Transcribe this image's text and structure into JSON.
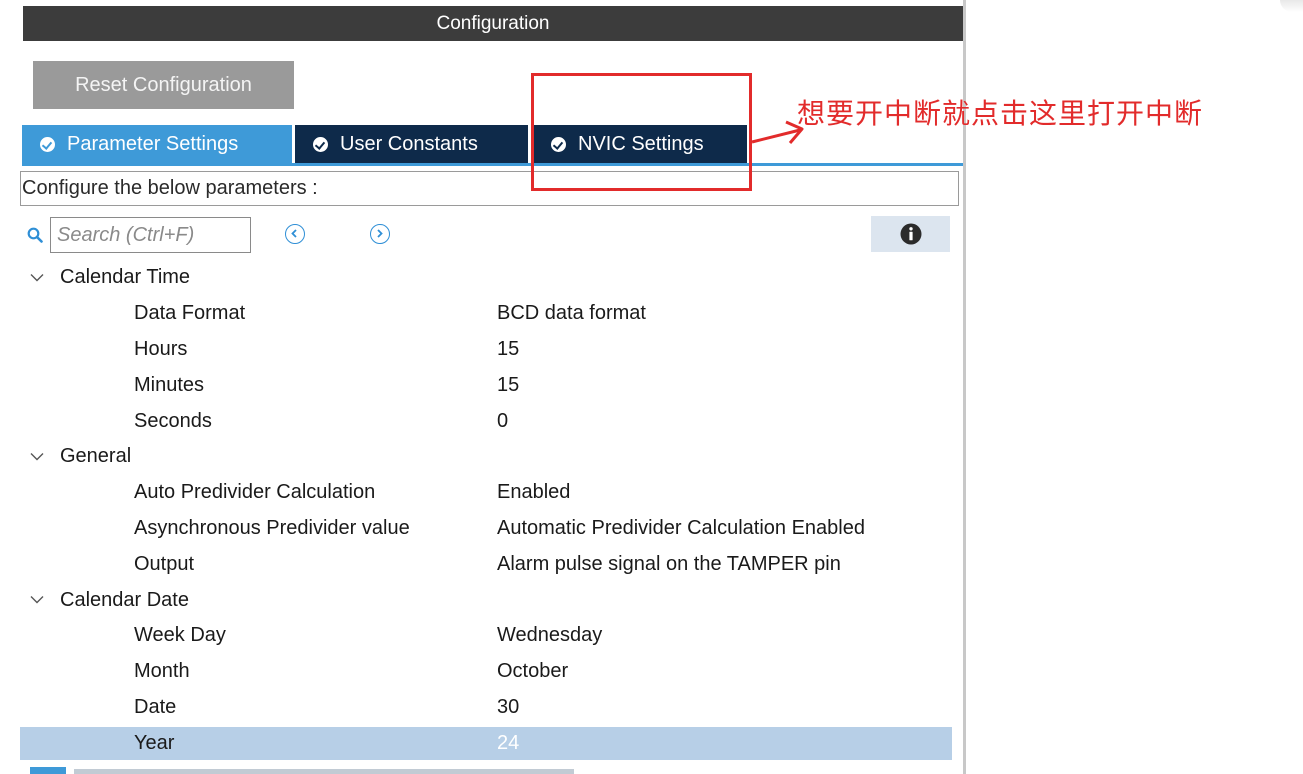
{
  "window": {
    "title": "Configuration"
  },
  "toolbar": {
    "reset_label": "Reset Configuration"
  },
  "tabs": [
    {
      "label": "Parameter Settings",
      "active": true
    },
    {
      "label": "User Constants",
      "active": false
    },
    {
      "label": "NVIC Settings",
      "active": false
    }
  ],
  "configure_label": "Configure the below parameters :",
  "search": {
    "placeholder": "Search (Ctrl+F)"
  },
  "groups": [
    {
      "label": "Calendar Time",
      "params": [
        {
          "label": "Data Format",
          "value": "BCD data format"
        },
        {
          "label": "Hours",
          "value": "15"
        },
        {
          "label": "Minutes",
          "value": "15"
        },
        {
          "label": "Seconds",
          "value": "0"
        }
      ]
    },
    {
      "label": "General",
      "params": [
        {
          "label": "Auto Predivider Calculation",
          "value": "Enabled"
        },
        {
          "label": "Asynchronous Predivider value",
          "value": "Automatic Predivider Calculation Enabled"
        },
        {
          "label": "Output",
          "value": "Alarm pulse signal on the TAMPER pin"
        }
      ]
    },
    {
      "label": "Calendar Date",
      "params": [
        {
          "label": "Week Day",
          "value": "Wednesday"
        },
        {
          "label": "Month",
          "value": "October"
        },
        {
          "label": "Date",
          "value": "30"
        },
        {
          "label": "Year",
          "value": "24",
          "selected": true
        }
      ]
    }
  ],
  "annotation": {
    "text": "想要开中断就点击这里打开中断",
    "color": "#e22b2b"
  },
  "colors": {
    "accent": "#3e9ad8",
    "tab_dark": "#0e2a4a",
    "titlebar": "#3c3c3c",
    "selected_row": "#b7cfe7"
  },
  "icons": [
    "check-circle-icon",
    "search-icon",
    "chevron-left-circle-icon",
    "chevron-right-circle-icon",
    "info-icon",
    "chevron-down-icon",
    "arrow-icon"
  ]
}
